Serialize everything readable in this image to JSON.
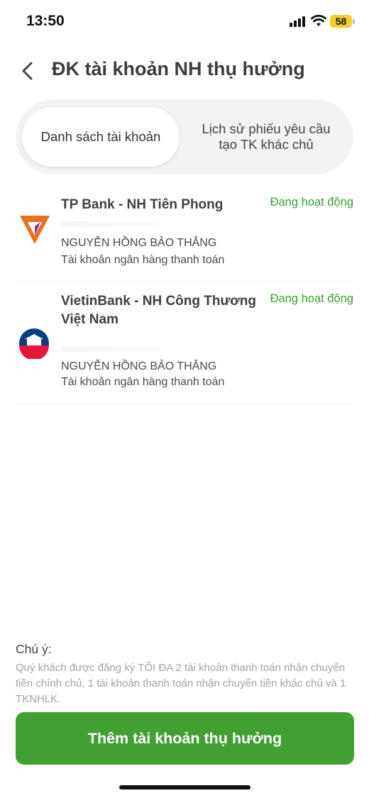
{
  "status_bar": {
    "time": "13:50",
    "battery": "58"
  },
  "header": {
    "title": "ĐK tài khoản NH thụ hưởng"
  },
  "tabs": [
    {
      "label": "Danh sách tài khoản",
      "active": true
    },
    {
      "label_line1": "Lịch sử phiếu yêu cầu",
      "label_line2": "tạo TK khác chủ",
      "active": false
    }
  ],
  "accounts": [
    {
      "bank_name": "TP Bank - NH Tiên Phong",
      "status": "Đang hoạt động",
      "holder": "NGUYỄN HỒNG BẢO THẮNG",
      "type": "Tài khoản ngân hàng thanh toán",
      "logo": "tpbank-logo",
      "logo_color": "#e8711f"
    },
    {
      "bank_name": "VietinBank - NH Công Thương Việt Nam",
      "status": "Đang hoạt động",
      "holder": "NGUYỄN HỒNG BẢO THẮNG",
      "type": "Tài khoản ngân hàng thanh toán",
      "logo": "vietinbank-logo",
      "logo_color": "#0b3d82"
    }
  ],
  "note": {
    "title": "Chú ý:",
    "text": "Quý khách được đăng ký TỐI ĐA 2 tài khoản thanh toán nhận chuyển tiền chính chủ, 1 tài khoản thanh toán nhận chuyển tiền khác chủ và 1 TKNHLK."
  },
  "add_button": {
    "label": "Thêm tài khoản thụ hưởng"
  },
  "colors": {
    "accent": "#42a033",
    "status": "#3e9c33"
  }
}
